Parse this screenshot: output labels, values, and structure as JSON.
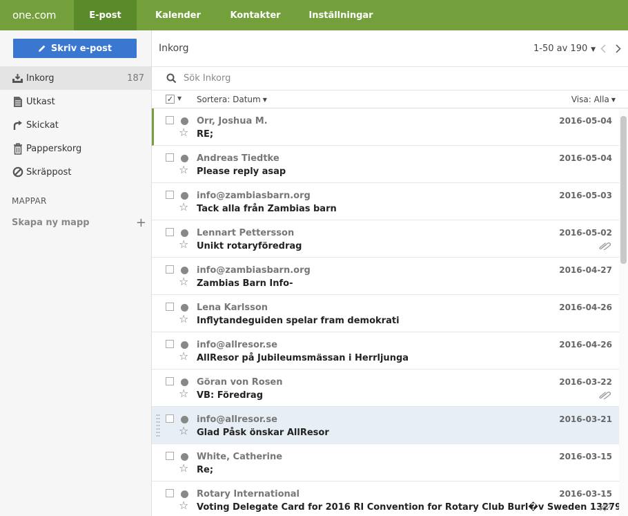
{
  "brand": {
    "logo": "one.com"
  },
  "nav": {
    "tabs": [
      {
        "label": "E-post",
        "active": true
      },
      {
        "label": "Kalender"
      },
      {
        "label": "Kontakter"
      },
      {
        "label": "Inställningar"
      }
    ]
  },
  "sidebar": {
    "compose_label": "Skriv e-post",
    "folders": [
      {
        "label": "Inkorg",
        "count": "187",
        "icon": "inbox-icon",
        "active": true
      },
      {
        "label": "Utkast",
        "icon": "draft-icon"
      },
      {
        "label": "Skickat",
        "icon": "sent-icon"
      },
      {
        "label": "Papperskorg",
        "icon": "trash-icon"
      },
      {
        "label": "Skräppost",
        "icon": "spam-icon"
      }
    ],
    "section_title": "MAPPAR",
    "new_folder_label": "Skapa ny mapp",
    "new_folder_plus": "+"
  },
  "main": {
    "title": "Inkorg",
    "pager_label": "1-50 av 190",
    "search_placeholder": "Sök Inkorg",
    "sort_label": "Sortera: Datum",
    "show_label": "Visa: Alla"
  },
  "messages": [
    {
      "from": "Orr, Joshua M.",
      "subject": "RE;",
      "date": "2016-05-04",
      "attachment": false
    },
    {
      "from": "Andreas Tiedtke",
      "subject": "Please reply asap",
      "date": "2016-05-04",
      "attachment": false
    },
    {
      "from": "info@zambiasbarn.org",
      "subject": "Tack alla från Zambias barn",
      "date": "2016-05-03",
      "attachment": false
    },
    {
      "from": "Lennart Pettersson",
      "subject": "Unikt rotaryföredrag",
      "date": "2016-05-02",
      "attachment": true
    },
    {
      "from": "info@zambiasbarn.org",
      "subject": "Zambias Barn Info-",
      "date": "2016-04-27",
      "attachment": false
    },
    {
      "from": "Lena Karlsson",
      "subject": "Inflytandeguiden spelar fram demokrati",
      "date": "2016-04-26",
      "attachment": false
    },
    {
      "from": "info@allresor.se",
      "subject": "AllResor på Jubileumsmässan i Herrljunga",
      "date": "2016-04-26",
      "attachment": false
    },
    {
      "from": "Göran von Rosen",
      "subject": "VB: Föredrag",
      "date": "2016-03-22",
      "attachment": true
    },
    {
      "from": "info@allresor.se",
      "subject": "Glad Påsk önskar AllResor",
      "date": "2016-03-21",
      "attachment": false
    },
    {
      "from": "White, Catherine",
      "subject": "Re;",
      "date": "2016-03-15",
      "attachment": false
    },
    {
      "from": "Rotary International",
      "subject": "Voting Delegate Card for 2016 RI Convention for Rotary Club Burl�v Sweden 13279",
      "date": "2016-03-15",
      "attachment": true
    }
  ],
  "colors": {
    "topbar": "#74a03c",
    "active_tab": "#5a8a2a",
    "compose": "#3a77d0",
    "highlight_row": "#e8eef6"
  }
}
